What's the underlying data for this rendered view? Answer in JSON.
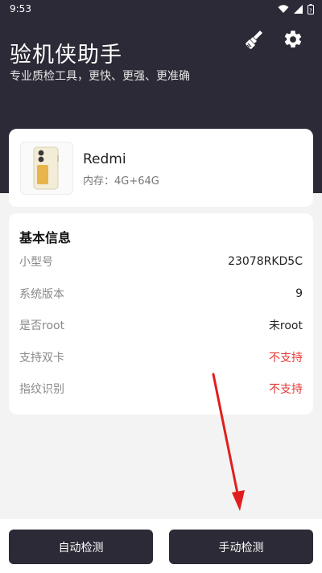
{
  "status_bar": {
    "time": "9:53"
  },
  "header": {
    "title": "验机侠助手",
    "subtitle": "专业质检工具，更快、更强、更准确",
    "icons": [
      "broom-icon",
      "gear-icon"
    ]
  },
  "device": {
    "name": "Redmi",
    "memory": "内存：4G+64G"
  },
  "info": {
    "title": "基本信息",
    "rows": [
      {
        "label": "小型号",
        "value": "23078RKD5C"
      },
      {
        "label": "系统版本",
        "value": "9"
      },
      {
        "label": "是否root",
        "value": "未root"
      },
      {
        "label": "支持双卡",
        "value": "不支持"
      },
      {
        "label": "指纹识别",
        "value": "不支持"
      }
    ]
  },
  "actions": {
    "auto": "自动检测",
    "manual": "手动检测"
  },
  "colors": {
    "header_bg": "#2b2a36",
    "warn": "#e53935"
  }
}
